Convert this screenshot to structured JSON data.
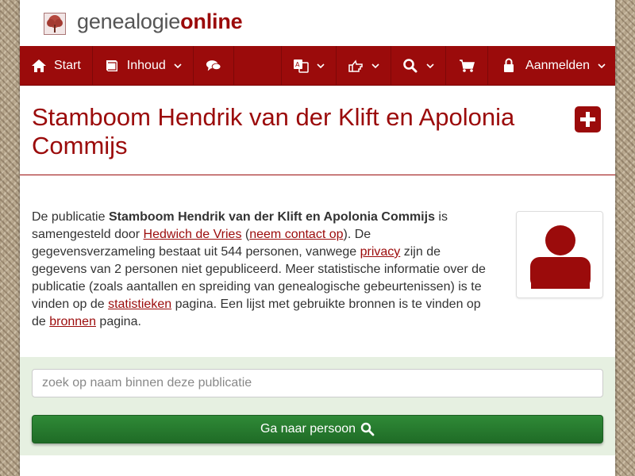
{
  "brand": {
    "part1": "genealogie",
    "part2": "online"
  },
  "nav": {
    "start_label": "Start",
    "inhoud_label": "Inhoud",
    "aanmelden_label": "Aanmelden"
  },
  "page": {
    "title": "Stamboom Hendrik van der Klift en Apolonia Commijs"
  },
  "intro": {
    "t1": "De publicatie ",
    "pub_name": "Stamboom Hendrik van der Klift en Apolonia Commijs",
    "t2": " is samengesteld door ",
    "author": "Hedwich de Vries",
    "t3": " (",
    "contact": "neem contact op",
    "t4": "). De gegevensverzameling bestaat uit 544 personen, vanwege ",
    "privacy": "privacy",
    "t5": " zijn de gegevens van 2 personen niet gepubliceerd. Meer statistische informatie over de publicatie (zoals aantallen en spreiding van genealogische gebeurtenissen) is te vinden op de ",
    "stats": "statistieken",
    "t6": " pagina. Een lijst met gebruikte bronnen is te vinden op de ",
    "sources": "bronnen",
    "t7": " pagina."
  },
  "search": {
    "placeholder": "zoek op naam binnen deze publicatie",
    "value": "",
    "button_label": "Ga naar persoon"
  },
  "colors": {
    "brand_red": "#9b0b0b",
    "button_green": "#287a30",
    "search_bg": "#e6f0e1"
  },
  "icons": [
    "home-icon",
    "book-icon",
    "comments-icon",
    "translate-icon",
    "hand-point-icon",
    "search-icon",
    "cart-icon",
    "lock-icon",
    "plus-square-icon",
    "user-avatar-icon",
    "chevron-down-icon"
  ]
}
